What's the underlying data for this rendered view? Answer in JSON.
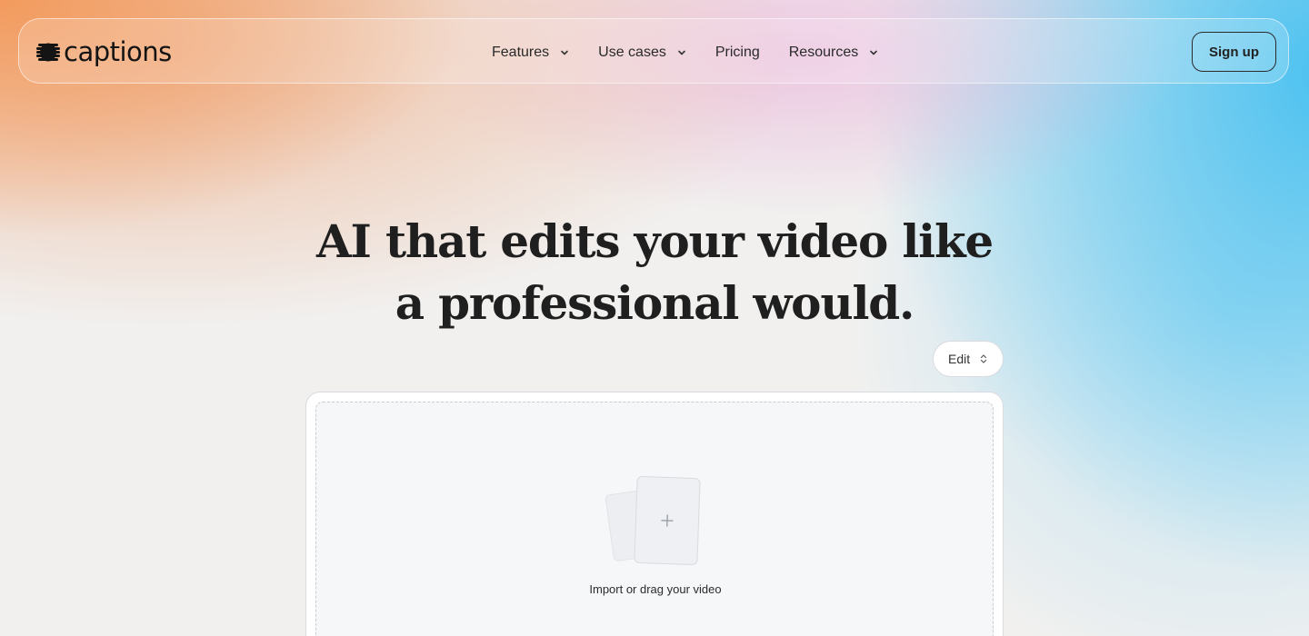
{
  "brand": {
    "name": "captions",
    "logo_icon": "captions-logo-icon"
  },
  "nav": {
    "items": [
      {
        "label": "Features",
        "has_dropdown": true
      },
      {
        "label": "Use cases",
        "has_dropdown": true
      },
      {
        "label": "Pricing",
        "has_dropdown": false
      },
      {
        "label": "Resources",
        "has_dropdown": true
      }
    ],
    "signup_label": "Sign up"
  },
  "hero": {
    "title": "AI that edits your video like a professional would."
  },
  "mode_select": {
    "value": "Edit",
    "icon": "chevron-up-down-icon"
  },
  "upload": {
    "label": "Import or drag your video",
    "icon": "plus-icon"
  },
  "colors": {
    "gradient_orange": "#f39858",
    "gradient_blue": "#40bef0",
    "gradient_pink": "#e8aad7",
    "text_dark": "#1f1f1f"
  }
}
